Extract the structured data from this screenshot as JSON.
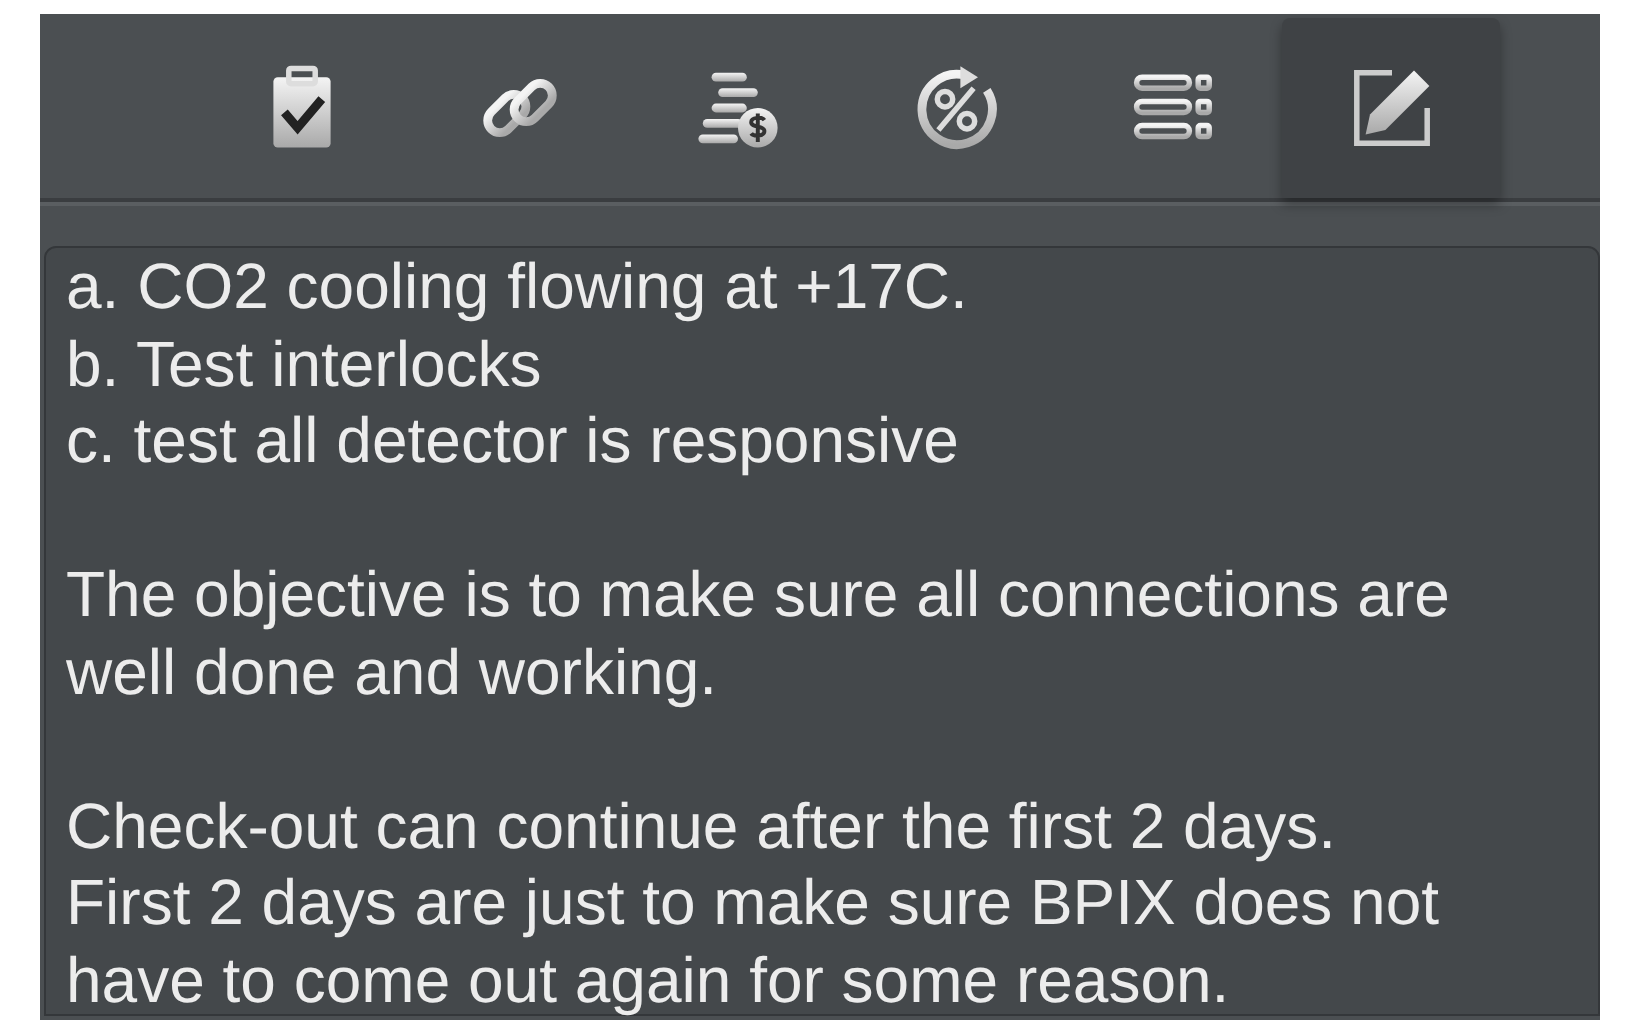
{
  "toolbar": {
    "tabs": [
      {
        "kind": "clipboard",
        "selected": false
      },
      {
        "kind": "link",
        "selected": false
      },
      {
        "kind": "coins",
        "selected": false
      },
      {
        "kind": "percent",
        "selected": false
      },
      {
        "kind": "list",
        "selected": false
      },
      {
        "kind": "edit",
        "selected": true
      }
    ]
  },
  "notes": {
    "paragraphs": [
      [
        "a. CO2 cooling flowing at +17C.",
        "b. Test interlocks",
        "c. test all detector is responsive"
      ],
      [
        "The objective is to make sure all connections are",
        "well done and working."
      ],
      [
        "Check-out can continue after the first 2 days.",
        "First 2 days are just to make sure BPIX does not",
        "have to come out again for some reason."
      ]
    ]
  }
}
